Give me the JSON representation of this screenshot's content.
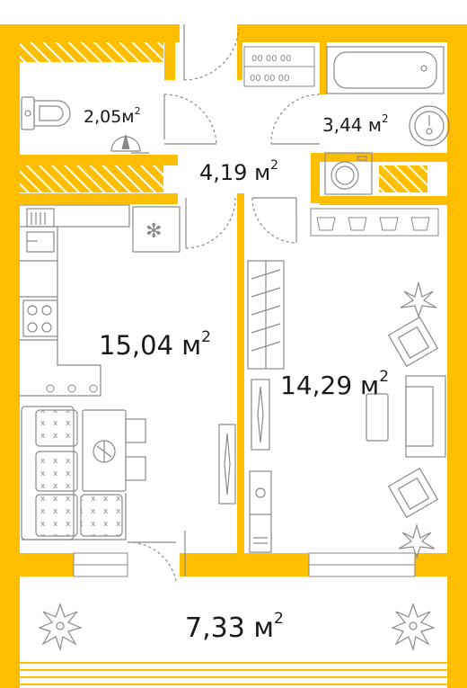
{
  "plan": {
    "colors": {
      "wall": "#FFBF00",
      "line": "#8a8a8a",
      "text": "#1a1a1a",
      "background": "#ffffff"
    },
    "rooms": [
      {
        "id": "wc",
        "area_text": "2,05м",
        "sup": "2"
      },
      {
        "id": "bathroom",
        "area_text": "3,44 м",
        "sup": "2"
      },
      {
        "id": "hall",
        "area_text": "4,19 м",
        "sup": "2"
      },
      {
        "id": "kitchen",
        "area_text": "15,04 м",
        "sup": "2"
      },
      {
        "id": "living",
        "area_text": "14,29 м",
        "sup": "2"
      },
      {
        "id": "balcony",
        "area_text": "7,33 м",
        "sup": "2"
      }
    ],
    "icons": [
      "toilet-icon",
      "boiler-icon",
      "sink-icon",
      "bathtub-icon",
      "washing-machine-icon",
      "shoe-rack-icon",
      "hanger-icon",
      "stove-icon",
      "fridge-icon",
      "kitchen-sink-icon",
      "dining-table-icon",
      "pizza-icon",
      "sofa-icon",
      "armchair-icon",
      "plant-icon",
      "wardrobe-icon",
      "tv-icon"
    ]
  }
}
